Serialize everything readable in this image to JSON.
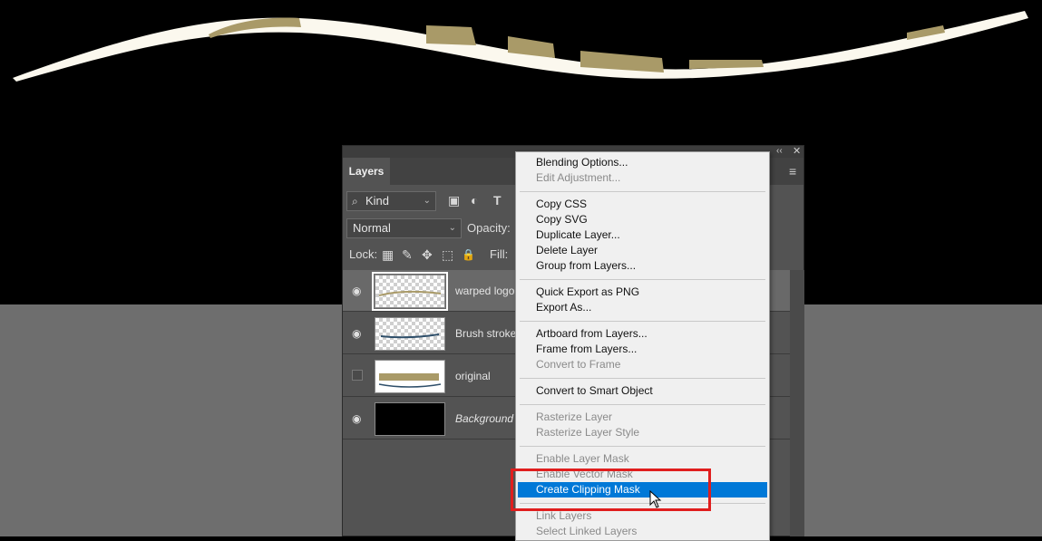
{
  "panel": {
    "tab_label": "Layers",
    "collapse_glyph": "‹‹",
    "close_glyph": "✕",
    "menu_glyph": "≡",
    "filter_kind": "Kind",
    "blend_mode": "Normal",
    "opacity_label": "Opacity:",
    "lock_label": "Lock:",
    "fill_label": "Fill:"
  },
  "icons": {
    "search": "search-icon",
    "filter_pixel": "image-icon",
    "filter_adjustment": "adjustment-icon",
    "filter_type": "type-icon",
    "lock_transparent": "checker-icon",
    "lock_pixels": "brush-icon",
    "lock_position": "move-icon",
    "lock_artboard": "artboard-icon",
    "lock_all": "lock-icon"
  },
  "glyphs": {
    "search": "⌕",
    "filter_pixel": "▣",
    "filter_adjustment": "◐",
    "filter_type": "T",
    "lock_transparent": "▦",
    "lock_pixels": "✎",
    "lock_position": "✥",
    "lock_artboard": "⬚",
    "lock_all": "🔒",
    "eye": "◉",
    "chevron": "⌄"
  },
  "layers": [
    {
      "name": "warped logo",
      "visible": true,
      "selected": true,
      "thumb": "transparent"
    },
    {
      "name": "Brush stroke",
      "visible": true,
      "selected": false,
      "thumb": "transparent"
    },
    {
      "name": "original",
      "visible": false,
      "selected": false,
      "thumb": "original"
    },
    {
      "name": "Background",
      "visible": true,
      "selected": false,
      "thumb": "black",
      "italic": true
    }
  ],
  "context_menu": {
    "items": [
      {
        "label": "Blending Options...",
        "enabled": true
      },
      {
        "label": "Edit Adjustment...",
        "enabled": false
      },
      {
        "label": "Copy CSS",
        "enabled": true
      },
      {
        "label": "Copy SVG",
        "enabled": true
      },
      {
        "label": "Duplicate Layer...",
        "enabled": true
      },
      {
        "label": "Delete Layer",
        "enabled": true
      },
      {
        "label": "Group from Layers...",
        "enabled": true
      },
      {
        "label": "Quick Export as PNG",
        "enabled": true
      },
      {
        "label": "Export As...",
        "enabled": true
      },
      {
        "label": "Artboard from Layers...",
        "enabled": true
      },
      {
        "label": "Frame from Layers...",
        "enabled": true
      },
      {
        "label": "Convert to Frame",
        "enabled": false
      },
      {
        "label": "Convert to Smart Object",
        "enabled": true
      },
      {
        "label": "Rasterize Layer",
        "enabled": false
      },
      {
        "label": "Rasterize Layer Style",
        "enabled": false
      },
      {
        "label": "Enable Layer Mask",
        "enabled": false
      },
      {
        "label": "Enable Vector Mask",
        "enabled": false
      },
      {
        "label": "Create Clipping Mask",
        "enabled": true,
        "highlighted": true
      },
      {
        "label": "Link Layers",
        "enabled": false
      },
      {
        "label": "Select Linked Layers",
        "enabled": false
      }
    ]
  },
  "colors": {
    "menu_highlight": "#0078d7",
    "annotation_box": "#e01e1e",
    "artwork_cream": "#fbf8ee",
    "artwork_tan": "#a99a68"
  }
}
